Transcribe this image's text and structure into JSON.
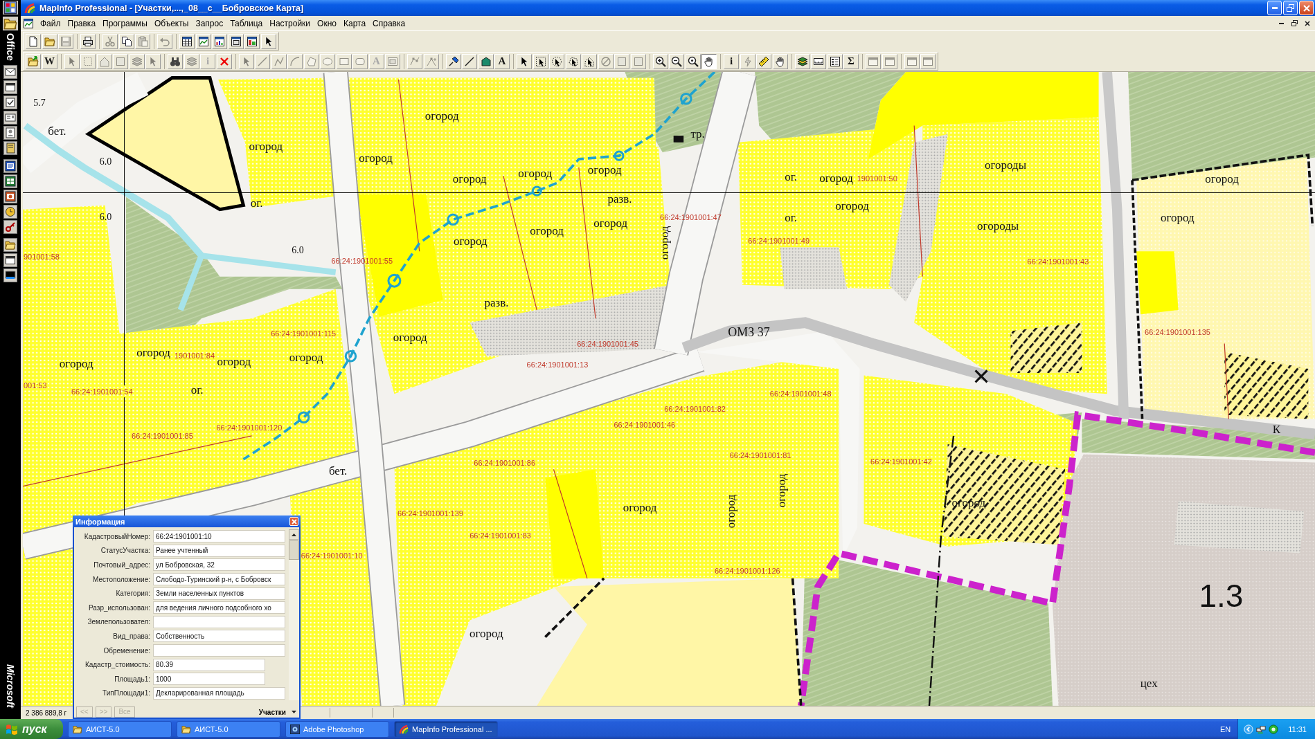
{
  "office_bar": {
    "title": "Office",
    "footer": "Microsoft"
  },
  "window": {
    "title": "MapInfo Professional - [Участки,...,_08__с__Бобровское Карта]"
  },
  "menu": [
    "Файл",
    "Правка",
    "Программы",
    "Объекты",
    "Запрос",
    "Таблица",
    "Настройки",
    "Окно",
    "Карта",
    "Справка"
  ],
  "toolbars": [
    {
      "groups": [
        [
          {
            "disabled": false
          },
          {
            "disabled": false
          },
          {
            "disabled": true
          }
        ],
        [
          {
            "disabled": false
          }
        ],
        [
          {
            "disabled": true
          },
          {
            "disabled": false
          },
          {
            "disabled": true
          }
        ],
        [
          {
            "disabled": true
          }
        ],
        [
          {
            "disabled": false
          },
          {
            "disabled": false
          },
          {
            "disabled": false
          },
          {
            "disabled": false
          },
          {
            "disabled": false
          },
          {
            "disabled": false
          }
        ]
      ]
    },
    {
      "groups": [
        [
          {
            "disabled": false,
            "selected": false
          },
          {
            "disabled": false,
            "selected": false,
            "glyph": "W"
          }
        ],
        [
          {
            "disabled": true,
            "selected": false
          },
          {
            "disabled": true,
            "selected": false
          },
          {
            "disabled": true,
            "selected": false
          },
          {
            "disabled": true,
            "selected": false
          },
          {
            "disabled": true,
            "selected": false
          },
          {
            "disabled": true,
            "selected": false
          }
        ],
        [
          {
            "disabled": false,
            "selected": false
          },
          {
            "disabled": true,
            "selected": false
          },
          {
            "disabled": true,
            "selected": false,
            "glyph": "i"
          },
          {
            "disabled": false,
            "selected": false
          }
        ],
        [
          {
            "disabled": true,
            "selected": false
          },
          {
            "disabled": true,
            "selected": false
          },
          {
            "disabled": true,
            "selected": false
          },
          {
            "disabled": true,
            "selected": false
          },
          {
            "disabled": true,
            "selected": false
          },
          {
            "disabled": true,
            "selected": false
          },
          {
            "disabled": true,
            "selected": false
          },
          {
            "disabled": true,
            "selected": false
          },
          {
            "disabled": true,
            "selected": false,
            "glyph": "A"
          },
          {
            "disabled": true,
            "selected": false
          }
        ],
        [
          {
            "disabled": true,
            "selected": false
          },
          {
            "disabled": true,
            "selected": false
          }
        ],
        [
          {
            "disabled": false,
            "selected": false
          },
          {
            "disabled": false,
            "selected": false
          },
          {
            "disabled": false,
            "selected": false
          },
          {
            "disabled": false,
            "selected": false,
            "glyph": "A"
          }
        ],
        [
          {
            "disabled": false,
            "selected": false
          },
          {
            "disabled": false,
            "selected": false
          },
          {
            "disabled": false,
            "selected": false
          },
          {
            "disabled": false,
            "selected": false
          },
          {
            "disabled": false,
            "selected": false
          },
          {
            "disabled": true,
            "selected": false
          },
          {
            "disabled": true,
            "selected": false
          },
          {
            "disabled": true,
            "selected": false
          }
        ],
        [
          {
            "disabled": false,
            "selected": false
          },
          {
            "disabled": false,
            "selected": false
          },
          {
            "disabled": false,
            "selected": false
          },
          {
            "disabled": false,
            "selected": true
          }
        ],
        [
          {
            "disabled": false,
            "selected": false,
            "glyph": "i"
          },
          {
            "disabled": true,
            "selected": false
          },
          {
            "disabled": false,
            "selected": false
          },
          {
            "disabled": false,
            "selected": false
          }
        ],
        [
          {
            "disabled": false,
            "selected": false
          },
          {
            "disabled": false,
            "selected": false
          },
          {
            "disabled": false,
            "selected": false
          },
          {
            "disabled": false,
            "selected": false,
            "glyph": "Σ"
          }
        ],
        [
          {
            "disabled": true,
            "selected": false
          },
          {
            "disabled": true,
            "selected": false
          }
        ],
        [
          {
            "disabled": true,
            "selected": false
          },
          {
            "disabled": true,
            "selected": false
          }
        ]
      ]
    }
  ],
  "map": {
    "labels": [
      {
        "text": "5.7",
        "kind": "elevation"
      },
      {
        "text": "огород",
        "kind": "word"
      },
      {
        "text": "бет.",
        "kind": "word"
      },
      {
        "text": "тр.",
        "kind": "word"
      },
      {
        "text": "огород",
        "kind": "word"
      },
      {
        "text": "6.0",
        "kind": "elevation"
      },
      {
        "text": "огород",
        "kind": "word"
      },
      {
        "text": "огороды",
        "kind": "word"
      },
      {
        "text": "огород",
        "kind": "word"
      },
      {
        "text": "огород",
        "kind": "word"
      },
      {
        "text": "огород",
        "kind": "word"
      },
      {
        "text": "ог.",
        "kind": "word"
      },
      {
        "text": "огород",
        "kind": "word"
      },
      {
        "text": "1901001:50",
        "kind": "parcel"
      },
      {
        "text": "огород",
        "kind": "word"
      },
      {
        "text": "ог.",
        "kind": "word"
      },
      {
        "text": "разв.",
        "kind": "word"
      },
      {
        "text": "огород",
        "kind": "word"
      },
      {
        "text": "6.0",
        "kind": "elevation"
      },
      {
        "text": "66:24:1901001:47",
        "kind": "parcel"
      },
      {
        "text": "ог.",
        "kind": "word"
      },
      {
        "text": "огород",
        "kind": "word"
      },
      {
        "text": "огород",
        "kind": "word"
      },
      {
        "text": "огород",
        "kind": "word"
      },
      {
        "text": "огороды",
        "kind": "word"
      },
      {
        "text": "огород",
        "kind": "word"
      },
      {
        "text": "огород",
        "kind": "vertical"
      },
      {
        "text": "66:24:1901001:49",
        "kind": "parcel"
      },
      {
        "text": "901001:58",
        "kind": "parcel"
      },
      {
        "text": "6.0",
        "kind": "elevation"
      },
      {
        "text": "66:24:1901001:55",
        "kind": "parcel"
      },
      {
        "text": "66:24:1901001:43",
        "kind": "parcel"
      },
      {
        "text": "разв.",
        "kind": "word"
      },
      {
        "text": "66:24:1901001:115",
        "kind": "parcel"
      },
      {
        "text": "огород",
        "kind": "word"
      },
      {
        "text": "66:24:1901001:45",
        "kind": "parcel"
      },
      {
        "text": "ОМЗ 37",
        "kind": "road"
      },
      {
        "text": "66:24:1901001:135",
        "kind": "parcel"
      },
      {
        "text": "огород",
        "kind": "word"
      },
      {
        "text": "огород",
        "kind": "word"
      },
      {
        "text": "1901001:84",
        "kind": "parcel"
      },
      {
        "text": "огород",
        "kind": "word"
      },
      {
        "text": "огород",
        "kind": "word"
      },
      {
        "text": "66:24:1901001:13",
        "kind": "parcel"
      },
      {
        "text": "001:53",
        "kind": "parcel"
      },
      {
        "text": "66:24:1901001:54",
        "kind": "parcel"
      },
      {
        "text": "ог.",
        "kind": "word"
      },
      {
        "text": "66:24:1901001:48",
        "kind": "parcel"
      },
      {
        "text": "66:24:1901001:82",
        "kind": "parcel"
      },
      {
        "text": "66:24:1901001:85",
        "kind": "parcel"
      },
      {
        "text": "66:24:1901001:120",
        "kind": "parcel"
      },
      {
        "text": "66:24:1901001:46",
        "kind": "parcel"
      },
      {
        "text": "К",
        "kind": "word"
      },
      {
        "text": "66:24:1901001:86",
        "kind": "parcel"
      },
      {
        "text": "66:24:1901001:81",
        "kind": "parcel"
      },
      {
        "text": "66:24:1901001:42",
        "kind": "parcel"
      },
      {
        "text": "бет.",
        "kind": "word"
      },
      {
        "text": "огород",
        "kind": "word"
      },
      {
        "text": "огород",
        "kind": "vertical"
      },
      {
        "text": "огород",
        "kind": "vertical"
      },
      {
        "text": "огород",
        "kind": "word"
      },
      {
        "text": "66:24:1901001:139",
        "kind": "parcel"
      },
      {
        "text": "66:24:1901001:83",
        "kind": "parcel"
      },
      {
        "text": "66:24:1901001:10",
        "kind": "parcel"
      },
      {
        "text": "66:24:1901001:126",
        "kind": "parcel"
      },
      {
        "text": "1.3",
        "kind": "zone"
      },
      {
        "text": "огород",
        "kind": "word"
      },
      {
        "text": "цех",
        "kind": "word"
      }
    ]
  },
  "info_panel": {
    "title": "Информация",
    "fields": [
      {
        "label": "КадастровыйНомер:",
        "value": "66:24:1901001:10",
        "kind": "text"
      },
      {
        "label": "СтатусУчастка:",
        "value": "Ранее учтенный",
        "kind": "text"
      },
      {
        "label": "Почтовый_адрес:",
        "value": "ул Бобровская, 32",
        "kind": "text"
      },
      {
        "label": "Местоположение:",
        "value": "Слободо-Туринский р-н, с Бобровск",
        "kind": "text"
      },
      {
        "label": "Категория:",
        "value": "Земли населенных пунктов",
        "kind": "text"
      },
      {
        "label": "Разр_использован:",
        "value": "для ведения личного подсобного хо",
        "kind": "text"
      },
      {
        "label": "Землепользовател:",
        "kind": "text"
      },
      {
        "label": "Вид_права:",
        "value": "Собственность",
        "kind": "text"
      },
      {
        "label": "Обременение:",
        "kind": "text"
      },
      {
        "label": "Кадастр_стоимость:",
        "value": "80.39",
        "kind": "number"
      },
      {
        "label": "Площадь1:",
        "value": "1000",
        "kind": "number"
      },
      {
        "label": "ТипПлощади1:",
        "value": "Декларированная площадь",
        "kind": "text"
      }
    ],
    "nav_buttons": [
      {
        "label": "<<",
        "disabled": true
      },
      {
        "label": ">>",
        "disabled": true
      },
      {
        "label": "Все",
        "disabled": true
      }
    ],
    "layer": "Участки"
  },
  "status_bar": {
    "coordinates": "2 386 889,8 г"
  },
  "taskbar": {
    "start": "пуск",
    "tasks": [
      {
        "label": "АИСТ-5.0",
        "selected": false
      },
      {
        "label": "АИСТ-5.0",
        "selected": false
      },
      {
        "label": "Adobe Photoshop",
        "selected": false
      },
      {
        "label": "MapInfo Professional ...",
        "selected": true
      }
    ],
    "language": "EN",
    "clock": "11:31"
  }
}
